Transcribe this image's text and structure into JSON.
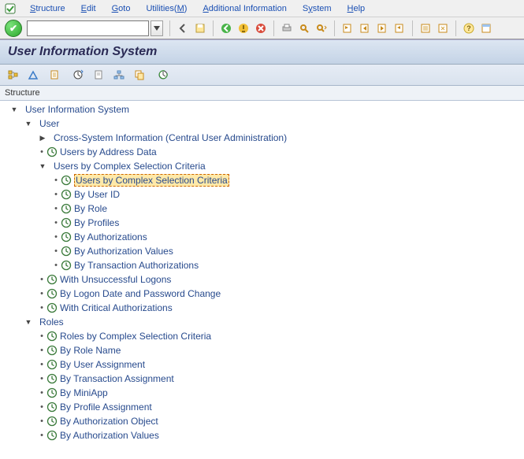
{
  "menu": {
    "items": [
      {
        "html": "<span class='u'>S</span>tructure"
      },
      {
        "html": "<span class='u'>E</span>dit"
      },
      {
        "html": "<span class='u'>G</span>oto"
      },
      {
        "html": "Utilities(<span class='u'>M</span>)"
      },
      {
        "html": "<span class='u'>A</span>dditional Information"
      },
      {
        "html": "S<span class='u'>y</span>stem"
      },
      {
        "html": "<span class='u'>H</span>elp"
      }
    ]
  },
  "title": "User Information System",
  "structure_header": "Structure",
  "tree": [
    {
      "indent": 12,
      "tw": "▼",
      "clock": false,
      "label": "User Information System"
    },
    {
      "indent": 30,
      "tw": "▼",
      "clock": false,
      "label": "User"
    },
    {
      "indent": 48,
      "tw": "▶",
      "clock": false,
      "label": "Cross-System Information (Central User Administration)"
    },
    {
      "indent": 48,
      "bullet": true,
      "clock": true,
      "label": "Users by Address Data"
    },
    {
      "indent": 48,
      "tw": "▼",
      "clock": false,
      "label": "Users by Complex Selection Criteria"
    },
    {
      "indent": 66,
      "bullet": true,
      "clock": true,
      "label": "Users by Complex Selection Criteria",
      "selected": true
    },
    {
      "indent": 66,
      "bullet": true,
      "clock": true,
      "label": "By User ID"
    },
    {
      "indent": 66,
      "bullet": true,
      "clock": true,
      "label": "By Role"
    },
    {
      "indent": 66,
      "bullet": true,
      "clock": true,
      "label": "By Profiles"
    },
    {
      "indent": 66,
      "bullet": true,
      "clock": true,
      "label": "By Authorizations"
    },
    {
      "indent": 66,
      "bullet": true,
      "clock": true,
      "label": "By Authorization Values"
    },
    {
      "indent": 66,
      "bullet": true,
      "clock": true,
      "label": "By Transaction Authorizations"
    },
    {
      "indent": 48,
      "bullet": true,
      "clock": true,
      "label": "With Unsuccessful Logons"
    },
    {
      "indent": 48,
      "bullet": true,
      "clock": true,
      "label": "By Logon Date and Password Change"
    },
    {
      "indent": 48,
      "bullet": true,
      "clock": true,
      "label": "With Critical Authorizations"
    },
    {
      "indent": 30,
      "tw": "▼",
      "clock": false,
      "label": "Roles"
    },
    {
      "indent": 48,
      "bullet": true,
      "clock": true,
      "label": "Roles by Complex Selection Criteria"
    },
    {
      "indent": 48,
      "bullet": true,
      "clock": true,
      "label": "By Role Name"
    },
    {
      "indent": 48,
      "bullet": true,
      "clock": true,
      "label": "By User Assignment"
    },
    {
      "indent": 48,
      "bullet": true,
      "clock": true,
      "label": "By Transaction Assignment"
    },
    {
      "indent": 48,
      "bullet": true,
      "clock": true,
      "label": "By MiniApp"
    },
    {
      "indent": 48,
      "bullet": true,
      "clock": true,
      "label": "By Profile Assignment"
    },
    {
      "indent": 48,
      "bullet": true,
      "clock": true,
      "label": "By Authorization Object"
    },
    {
      "indent": 48,
      "bullet": true,
      "clock": true,
      "label": "By Authorization Values"
    }
  ]
}
